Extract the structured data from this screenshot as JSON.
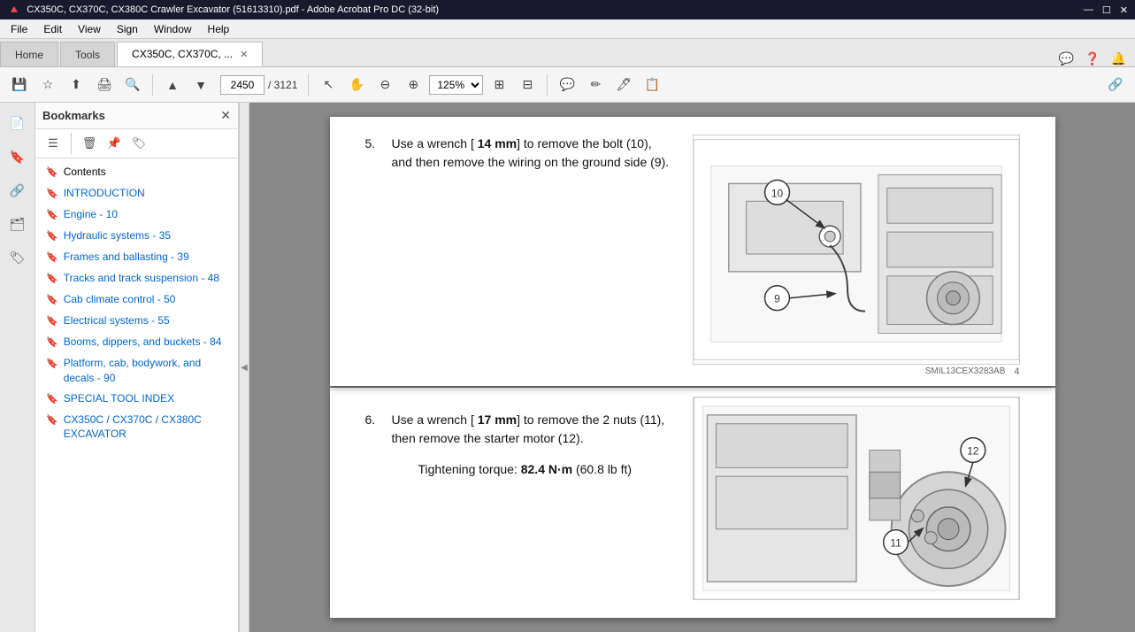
{
  "titleBar": {
    "title": "CX350C, CX370C, CX380C Crawler Excavator (51613310).pdf - Adobe Acrobat Pro DC (32-bit)",
    "minimize": "—",
    "maximize": "☐",
    "close": "✕"
  },
  "menuBar": {
    "items": [
      "File",
      "Edit",
      "View",
      "Sign",
      "Window",
      "Help"
    ]
  },
  "tabs": {
    "home": "Home",
    "tools": "Tools",
    "document": "CX350C, CX370C, ...",
    "closeIcon": "✕"
  },
  "toolbar": {
    "currentPage": "2450",
    "totalPages": "3121",
    "zoom": "125%",
    "pageInput_placeholder": "2450"
  },
  "sidebar": {
    "title": "Bookmarks",
    "bookmarks": [
      {
        "label": "Contents",
        "color": "black"
      },
      {
        "label": "INTRODUCTION",
        "color": "blue"
      },
      {
        "label": "Engine - 10",
        "color": "blue"
      },
      {
        "label": "Hydraulic systems - 35",
        "color": "blue"
      },
      {
        "label": "Frames and ballasting - 39",
        "color": "blue"
      },
      {
        "label": "Tracks and track suspension - 48",
        "color": "blue"
      },
      {
        "label": "Cab climate control - 50",
        "color": "blue"
      },
      {
        "label": "Electrical systems - 55",
        "color": "blue"
      },
      {
        "label": "Booms, dippers, and buckets - 84",
        "color": "blue"
      },
      {
        "label": "Platform, cab, bodywork, and decals - 90",
        "color": "blue"
      },
      {
        "label": "SPECIAL TOOL INDEX",
        "color": "blue"
      },
      {
        "label": "CX350C / CX370C / CX380C EXCAVATOR",
        "color": "blue"
      }
    ]
  },
  "document": {
    "step5": {
      "num": "5.",
      "text1": "Use a wrench [ ",
      "bold1": "14 mm",
      "text2": "] to remove the bolt (10), and then remove the wiring on the ground side (9)."
    },
    "step6": {
      "num": "6.",
      "text1": "Use a wrench [ ",
      "bold1": "17 mm",
      "text2": "] to remove the 2 nuts (11), then remove the starter motor (12)."
    },
    "tightening": {
      "label": "Tightening torque: ",
      "value": "82.4 N·m",
      "text2": " (60.8 lb ft)"
    },
    "imageCaption1": "SMIL13CEX3283AB",
    "imageCaption2": "4",
    "pageNum": "4"
  }
}
